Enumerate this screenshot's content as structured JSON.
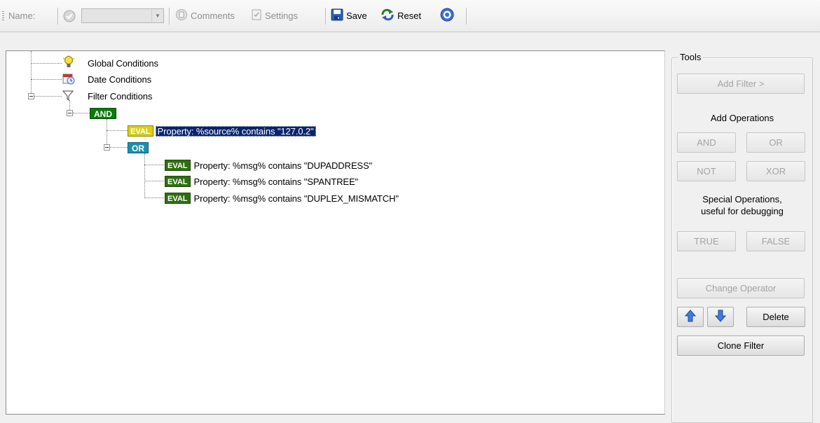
{
  "toolbar": {
    "name_label": "Name:",
    "name_value": "",
    "comments_label": "Comments",
    "settings_label": "Settings",
    "save_label": "Save",
    "reset_label": "Reset"
  },
  "tree": {
    "global": "Global Conditions",
    "date": "Date Conditions",
    "filter": "Filter Conditions",
    "and_label": "AND",
    "or_label": "OR",
    "eval_label": "EVAL",
    "rules": [
      "Property: %source% contains \"127.0.2\"",
      "Property: %msg% contains \"DUPADDRESS\"",
      "Property: %msg% contains \"SPANTREE\"",
      "Property: %msg% contains \"DUPLEX_MISMATCH\""
    ]
  },
  "tools": {
    "caption": "Tools",
    "add_filter": "Add Filter >",
    "add_operations": "Add Operations",
    "and": "AND",
    "or": "OR",
    "not": "NOT",
    "xor": "XOR",
    "special_line1": "Special Operations,",
    "special_line2": "useful for debugging",
    "true": "TRUE",
    "false": "FALSE",
    "change_operator": "Change Operator",
    "delete": "Delete",
    "clone_filter": "Clone Filter"
  },
  "colors": {
    "and_badge": "#0c7a0c",
    "or_badge": "#1c8fb0",
    "eval_badge": "#2f6f12",
    "eval_selected_badge": "#d9cf1a",
    "selection": "#0a246a"
  }
}
